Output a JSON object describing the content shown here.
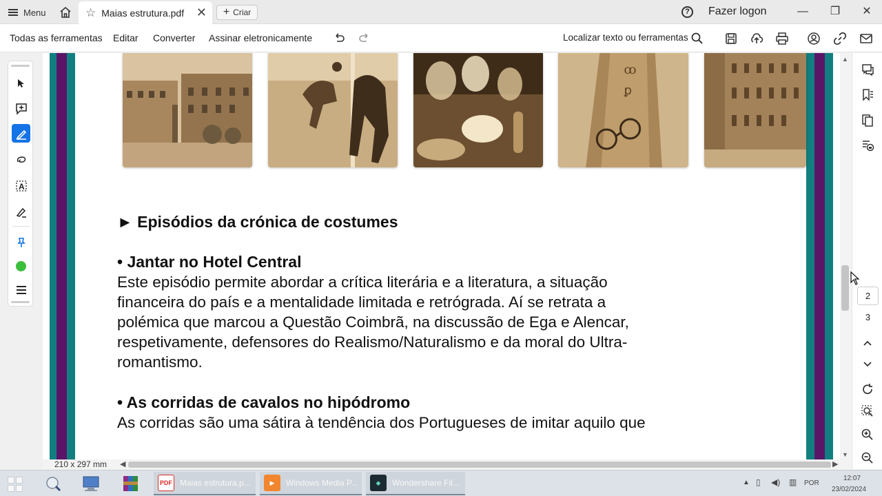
{
  "titlebar": {
    "menu_label": "Menu",
    "tab_title": "Maias estrutura.pdf",
    "new_tab_label": "Criar",
    "signin_label": "Fazer logon"
  },
  "toolbar": {
    "all_tools": "Todas as ferramentas",
    "edit": "Editar",
    "convert": "Converter",
    "sign": "Assinar eletronicamente",
    "search_label": "Localizar texto ou ferramentas"
  },
  "document": {
    "heading": "► Episódios da crónica de costumes",
    "sections": [
      {
        "title": "• Jantar no Hotel Central",
        "lines": [
          "Este episódio permite abordar a crítica literária e a literatura, a situação",
          "financeira do país e a mentalidade limitada e retrógrada. Aí se retrata a",
          "polémica que marcou a Questão Coimbrã, na discussão de Ega e Alencar,",
          "respetivamente, defensores do Realismo/Naturalismo e da moral do Ultra-",
          "romantismo."
        ]
      },
      {
        "title": "• As corridas de cavalos no hipódromo",
        "lines": [
          "As corridas são uma sátira à tendência dos Portugueses de imitar aquilo que"
        ]
      }
    ],
    "photos": [
      "lisbon-square-photo",
      "horse-race-photo",
      "dinner-glasses-photo",
      "book-glasses-photo",
      "street-engraving-photo"
    ],
    "border_colors": {
      "teal": "#117f80",
      "purple": "#5a1567"
    }
  },
  "status": {
    "page_size": "210 x 297 mm",
    "current_page": "2",
    "next_page": "3"
  },
  "taskbar": {
    "tasks": [
      {
        "label": "Maias estrutura.p...",
        "icon": "pdf-icon",
        "color": "#d9302c"
      },
      {
        "label": "Windows Media P...",
        "icon": "media-player-icon",
        "color": "#f2862e"
      },
      {
        "label": "Wondershare Fil...",
        "icon": "filmora-icon",
        "color": "#1c2a33"
      }
    ],
    "language": "POR",
    "time": "12:07",
    "date": "23/02/2024"
  }
}
